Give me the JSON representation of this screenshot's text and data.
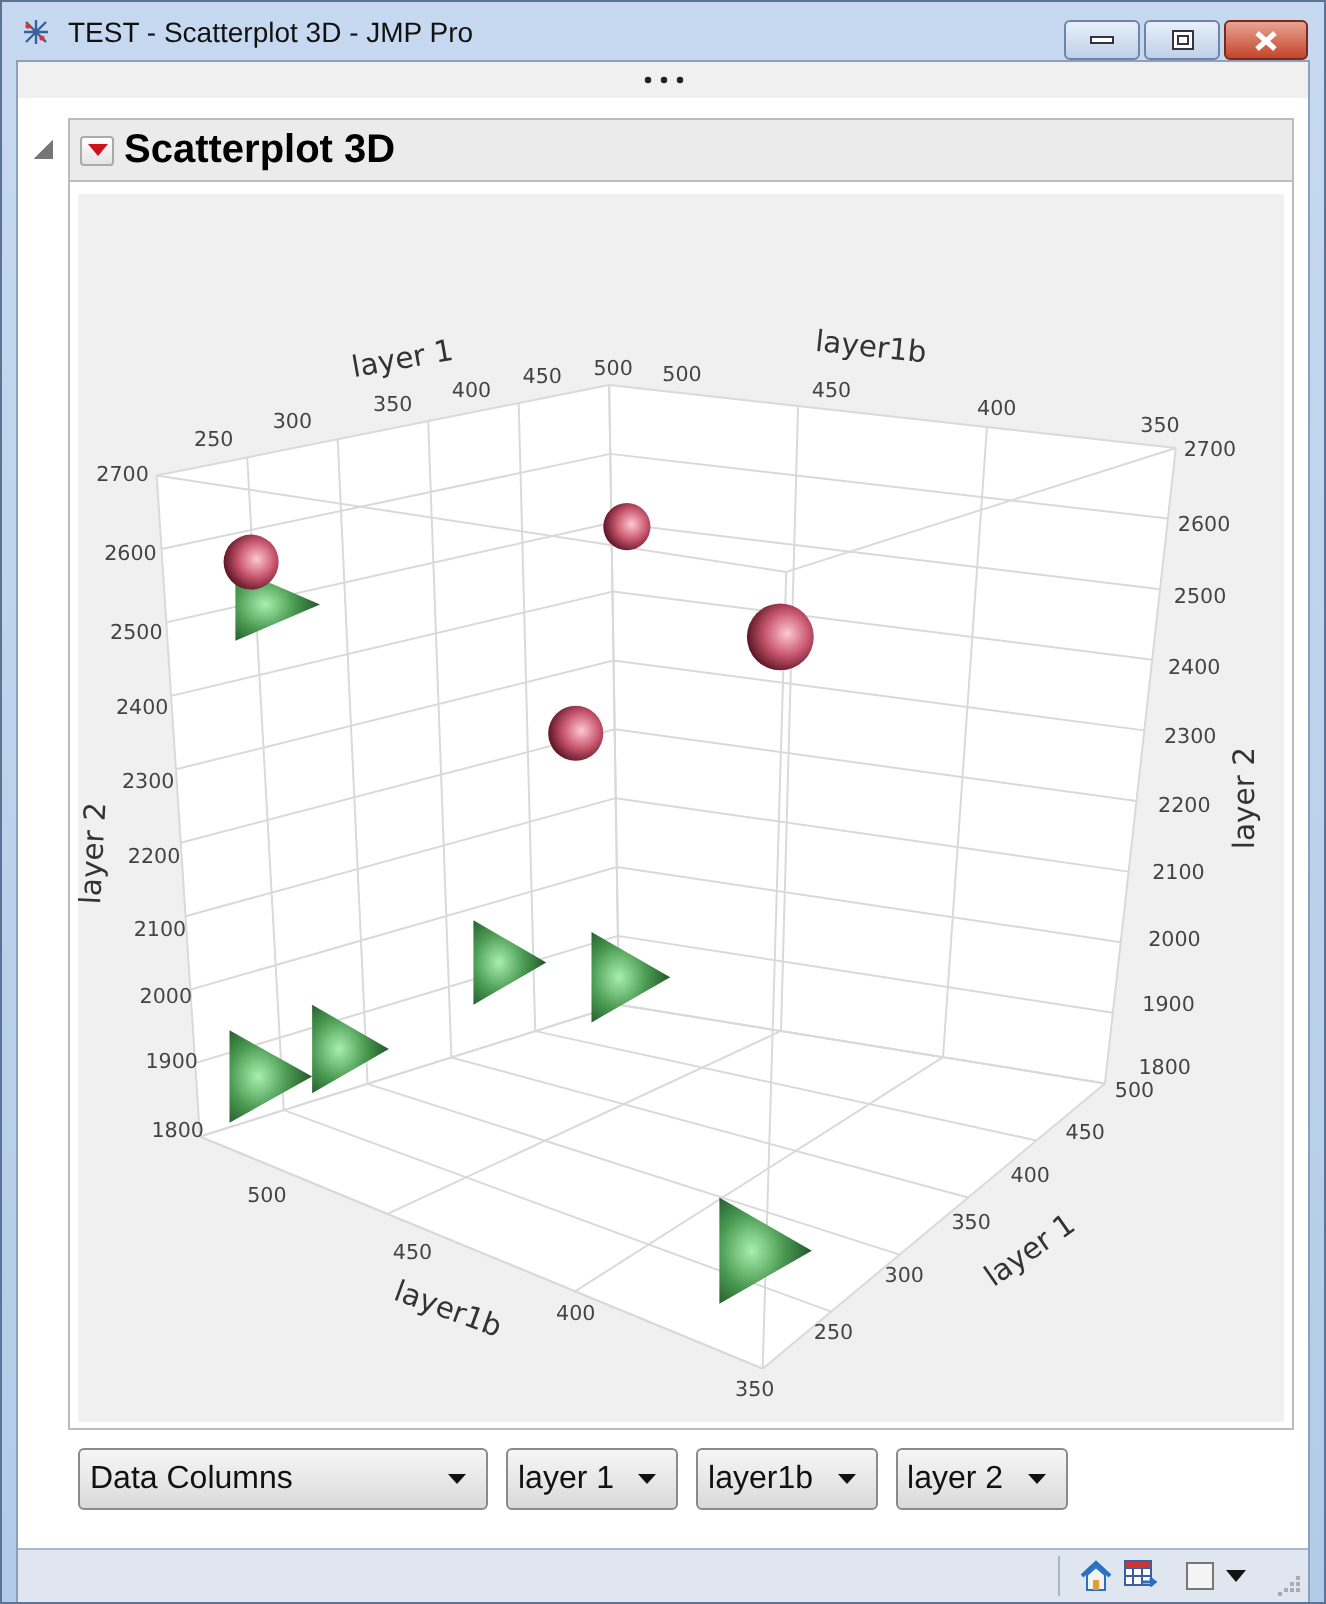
{
  "window": {
    "title": "TEST - Scatterplot 3D - JMP Pro"
  },
  "report": {
    "title": "Scatterplot 3D",
    "expanded": true
  },
  "plot": {
    "axes": [
      {
        "kind": "topleft",
        "title": "layer 1",
        "ticks": [
          "250",
          "300",
          "350",
          "400",
          "450",
          "500"
        ]
      },
      {
        "kind": "topright",
        "title": "layer1b",
        "ticks": [
          "500",
          "450",
          "400",
          "350"
        ]
      },
      {
        "kind": "left",
        "title": "layer 2",
        "ticks": [
          "2700",
          "2600",
          "2500",
          "2400",
          "2300",
          "2200",
          "2100",
          "2000",
          "1900",
          "1800"
        ]
      },
      {
        "kind": "bottomleft",
        "title": "layer1b",
        "ticks": [
          "500",
          "450",
          "400",
          "350"
        ]
      },
      {
        "kind": "right",
        "title": "layer 2",
        "ticks": [
          "2700",
          "2600",
          "2500",
          "2400",
          "2300",
          "2200",
          "2100",
          "2000",
          "1900",
          "1800"
        ]
      },
      {
        "kind": "bottomright",
        "title": "layer 1",
        "ticks": [
          "250",
          "300",
          "350",
          "400",
          "450",
          "500"
        ]
      }
    ],
    "markers": [
      {
        "kind": "triangle"
      },
      {
        "kind": "triangle"
      },
      {
        "kind": "triangle"
      },
      {
        "kind": "triangle"
      },
      {
        "kind": "triangle"
      },
      {
        "kind": "triangle"
      },
      {
        "kind": "sphere"
      },
      {
        "kind": "sphere"
      },
      {
        "kind": "sphere"
      },
      {
        "kind": "sphere"
      }
    ]
  },
  "dropdowns": [
    {
      "value": "Data Columns"
    },
    {
      "value": "layer 1"
    },
    {
      "value": "layer1b"
    },
    {
      "value": "layer 2"
    }
  ]
}
